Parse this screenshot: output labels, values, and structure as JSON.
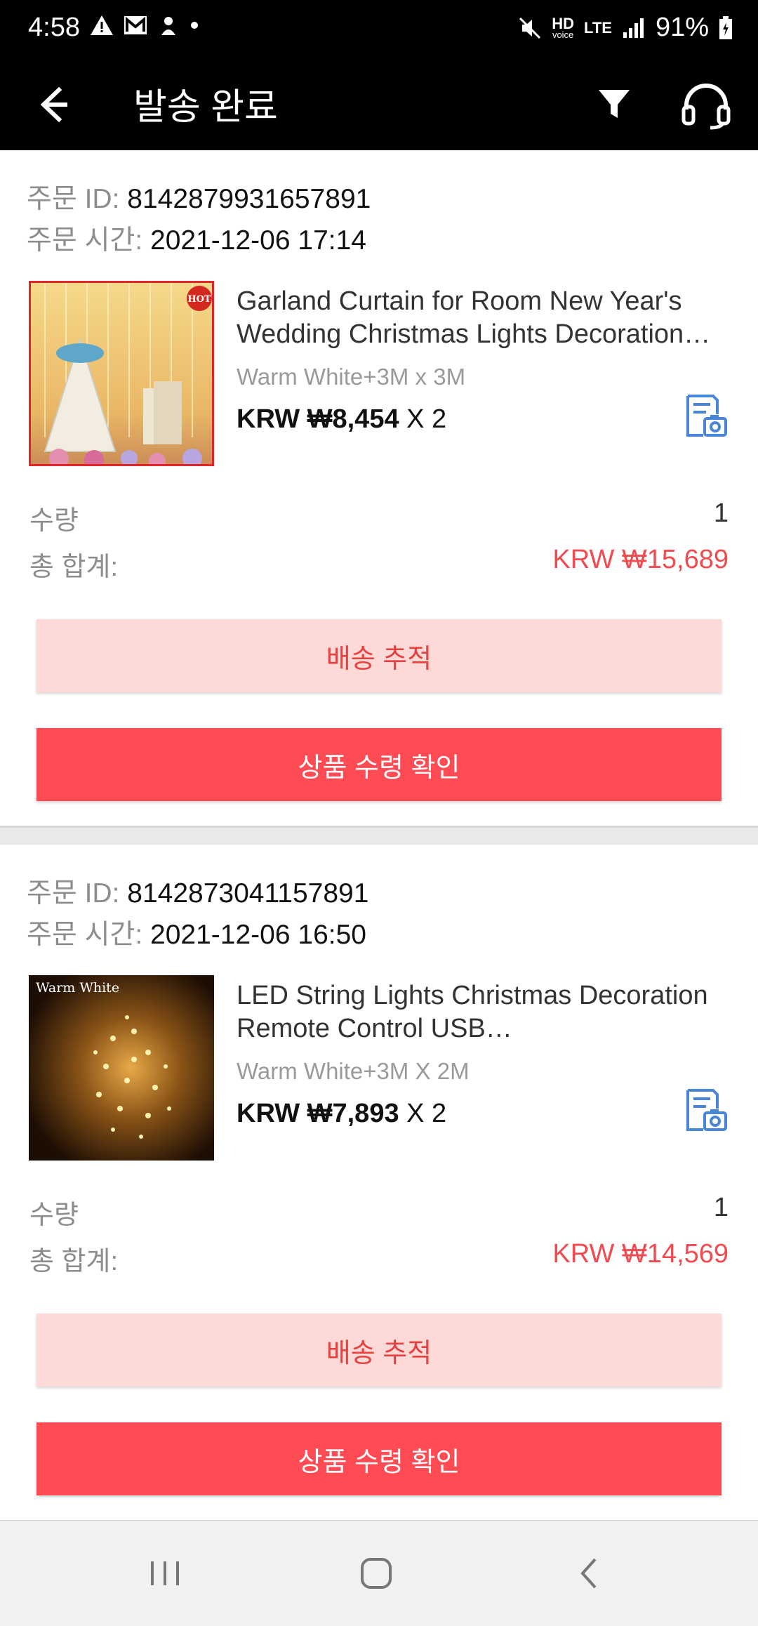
{
  "status_bar": {
    "time": "4:58",
    "signal_label_top": "HD",
    "signal_label_bottom": "voice",
    "lte": "LTE",
    "battery": "91%"
  },
  "app_bar": {
    "title": "발송 완료"
  },
  "orders": [
    {
      "id_label": "주문 ID:",
      "id_value": "8142879931657891",
      "time_label": "주문 시간:",
      "time_value": "2021-12-06 17:14",
      "thumb_badge": "HOT",
      "title": "Garland Curtain for Room New Year's Wedding Christmas Lights Decoration…",
      "variant": "Warm White+3M x 3M",
      "price": "KRW ₩8,454",
      "qty_suffix": "X 2",
      "qty_label": "수량",
      "qty_value": "1",
      "total_label": "총 합계:",
      "total_value": "KRW ₩15,689",
      "track_label": "배송 추적",
      "confirm_label": "상품 수령 확인"
    },
    {
      "id_label": "주문 ID:",
      "id_value": "8142873041157891",
      "time_label": "주문 시간:",
      "time_value": "2021-12-06 16:50",
      "thumb_badge": "Warm White",
      "title": "LED String Lights Christmas Decoration Remote Control USB…",
      "variant": "Warm White+3M X 2M",
      "price": "KRW ₩7,893",
      "qty_suffix": "X 2",
      "qty_label": "수량",
      "qty_value": "1",
      "total_label": "총 합계:",
      "total_value": "KRW ₩14,569",
      "track_label": "배송 추적",
      "confirm_label": "상품 수령 확인"
    }
  ],
  "colors": {
    "accent_red": "#ff4b53",
    "track_bg": "#fdd9d7",
    "total_red": "#ef4b50",
    "icon_blue": "#4a86d8"
  },
  "icons": [
    "back-arrow-icon",
    "filter-icon",
    "headset-icon",
    "photo-review-icon",
    "recents-icon",
    "home-icon",
    "back-icon"
  ]
}
